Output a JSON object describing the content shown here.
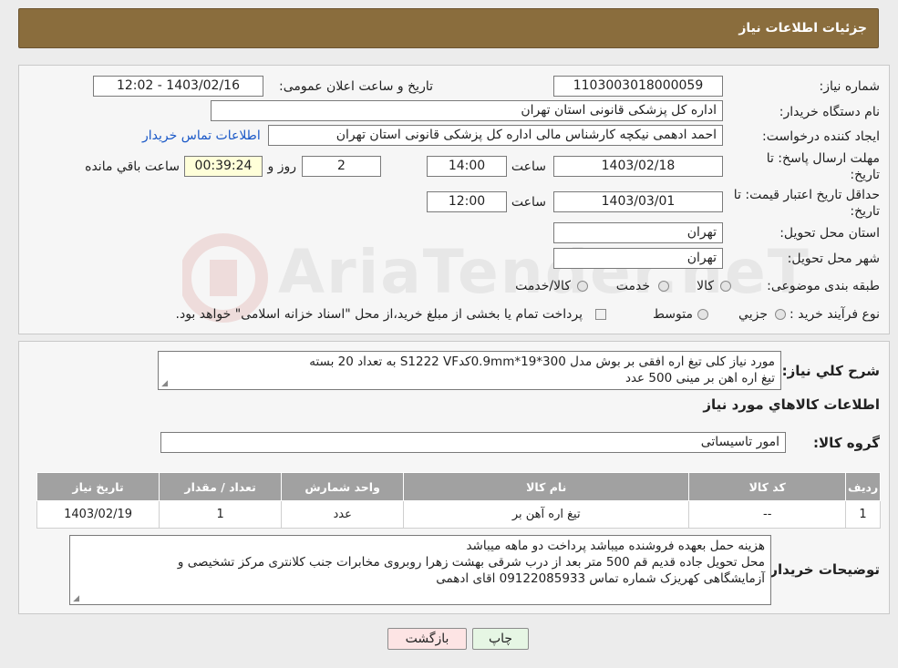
{
  "header": {
    "title": "جزئیات اطلاعات نیاز"
  },
  "fields": {
    "need_number_label": "شماره نیاز:",
    "need_number": "1103003018000059",
    "announce_label": "تاریخ و ساعت اعلان عمومی:",
    "announce_value": "1403/02/16 - 12:02",
    "buyer_org_label": "نام دستگاه خریدار:",
    "buyer_org": "اداره کل پزشکی قانونی استان تهران",
    "requester_label": "ایجاد کننده درخواست:",
    "requester": "احمد ادهمی نیکچه کارشناس مالی اداره کل پزشکی قانونی استان تهران",
    "contact_link": "اطلاعات تماس خریدار",
    "reply_deadline_label_1": "مهلت ارسال پاسخ: تا",
    "reply_deadline_label_2": "تاریخ:",
    "reply_date": "1403/02/18",
    "time_label": "ساعت",
    "reply_time": "14:00",
    "days_value": "2",
    "days_label": "روز و",
    "remaining_time": "00:39:24",
    "remaining_label": "ساعت باقي مانده",
    "validity_label_1": "حداقل تاریخ اعتبار قیمت: تا",
    "validity_label_2": "تاریخ:",
    "validity_date": "1403/03/01",
    "validity_time": "12:00",
    "province_label": "استان محل تحویل:",
    "province": "تهران",
    "city_label": "شهر محل تحویل:",
    "city": "تهران",
    "category_label": "طبقه بندی موضوعی:",
    "category_options": [
      "کالا",
      "خدمت",
      "کالا/خدمت"
    ],
    "process_label": "نوع فرآیند خرید :",
    "process_options": [
      "جزیي",
      "متوسط"
    ],
    "payment_note": "پرداخت تمام یا بخشی از مبلغ خرید،از محل \"اسناد خزانه اسلامی\" خواهد بود."
  },
  "summary": {
    "label": "شرح کلي نیاز:",
    "line1": "مورد نیاز کلی تیغ اره افقی بر بوش مدل       300*19*0.9mmکدS1222 VF به تعداد 20 بسته",
    "line2": "تیغ اره اهن بر مینی 500 عدد"
  },
  "goods_info": {
    "title": "اطلاعات کالاهاي مورد نیاز",
    "group_label": "گروه کالا:",
    "group_value": "امور تاسیساتی"
  },
  "table": {
    "headers": [
      "ردیف",
      "کد کالا",
      "نام کالا",
      "واحد شمارش",
      "تعداد / مقدار",
      "تاریخ نیاز"
    ],
    "rows": [
      [
        "1",
        "--",
        "تیغ اره آهن بر",
        "عدد",
        "1",
        "1403/02/19"
      ]
    ]
  },
  "buyer_notes": {
    "label": "توضیحات خریدار:",
    "line1": "هزینه حمل بعهده فروشنده میباشد پرداخت دو ماهه میباشد",
    "line2": "محل تحویل جاده قدیم قم 500 متر بعد از درب شرقی بهشت زهرا روبروی مخابرات جنب کلانتری مرکز تشخیصی و",
    "line3": "آزمایشگاهی کهریزک شماره تماس 09122085933 اقای ادهمی"
  },
  "buttons": {
    "print": "چاپ",
    "back": "بازگشت"
  },
  "watermark": {
    "text": "AriaTender.neT"
  },
  "colors": {
    "header_bg": "#8a6d3d",
    "link": "#1a58c7",
    "back_bg": "#fde4e4",
    "print_bg": "#e6f6e4"
  }
}
